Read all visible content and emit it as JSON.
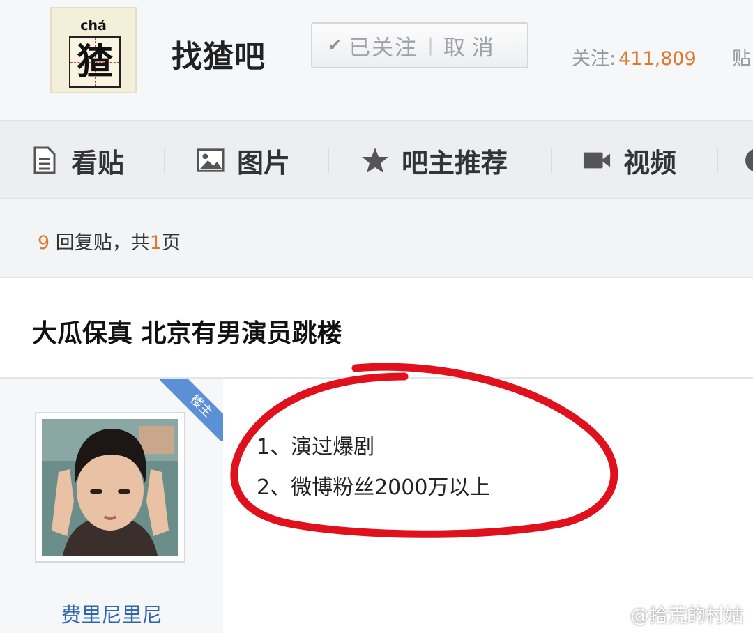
{
  "forum": {
    "logo_pinyin": "chá",
    "logo_char": "猹",
    "name": "找猹吧",
    "follow_check": "✔",
    "follow_state": "已关注",
    "follow_sep": "|",
    "follow_cancel": "取消",
    "followers_label": "关注:",
    "followers_count": "411,809",
    "posts_label": "贴"
  },
  "tabs": [
    {
      "label": "看贴",
      "icon": "document-icon"
    },
    {
      "label": "图片",
      "icon": "image-icon"
    },
    {
      "label": "吧主推荐",
      "icon": "star-icon"
    },
    {
      "label": "视频",
      "icon": "video-icon"
    }
  ],
  "thread": {
    "reply_count": "9",
    "reply_text": "回复贴，共",
    "page_count": "1",
    "page_unit": "页",
    "title": "大瓜保真 北京有男演员跳楼"
  },
  "post": {
    "badge": "楼主",
    "username": "费里尼里尼",
    "lines": [
      "1、演过爆剧",
      "2、微博粉丝2000万以上"
    ]
  },
  "watermark": "@拾荒的村姑",
  "colors": {
    "accent_orange": "#e0782c",
    "link_blue": "#2d64b3",
    "annotation_red": "#e0101c",
    "badge_blue": "#5b8fd6"
  }
}
